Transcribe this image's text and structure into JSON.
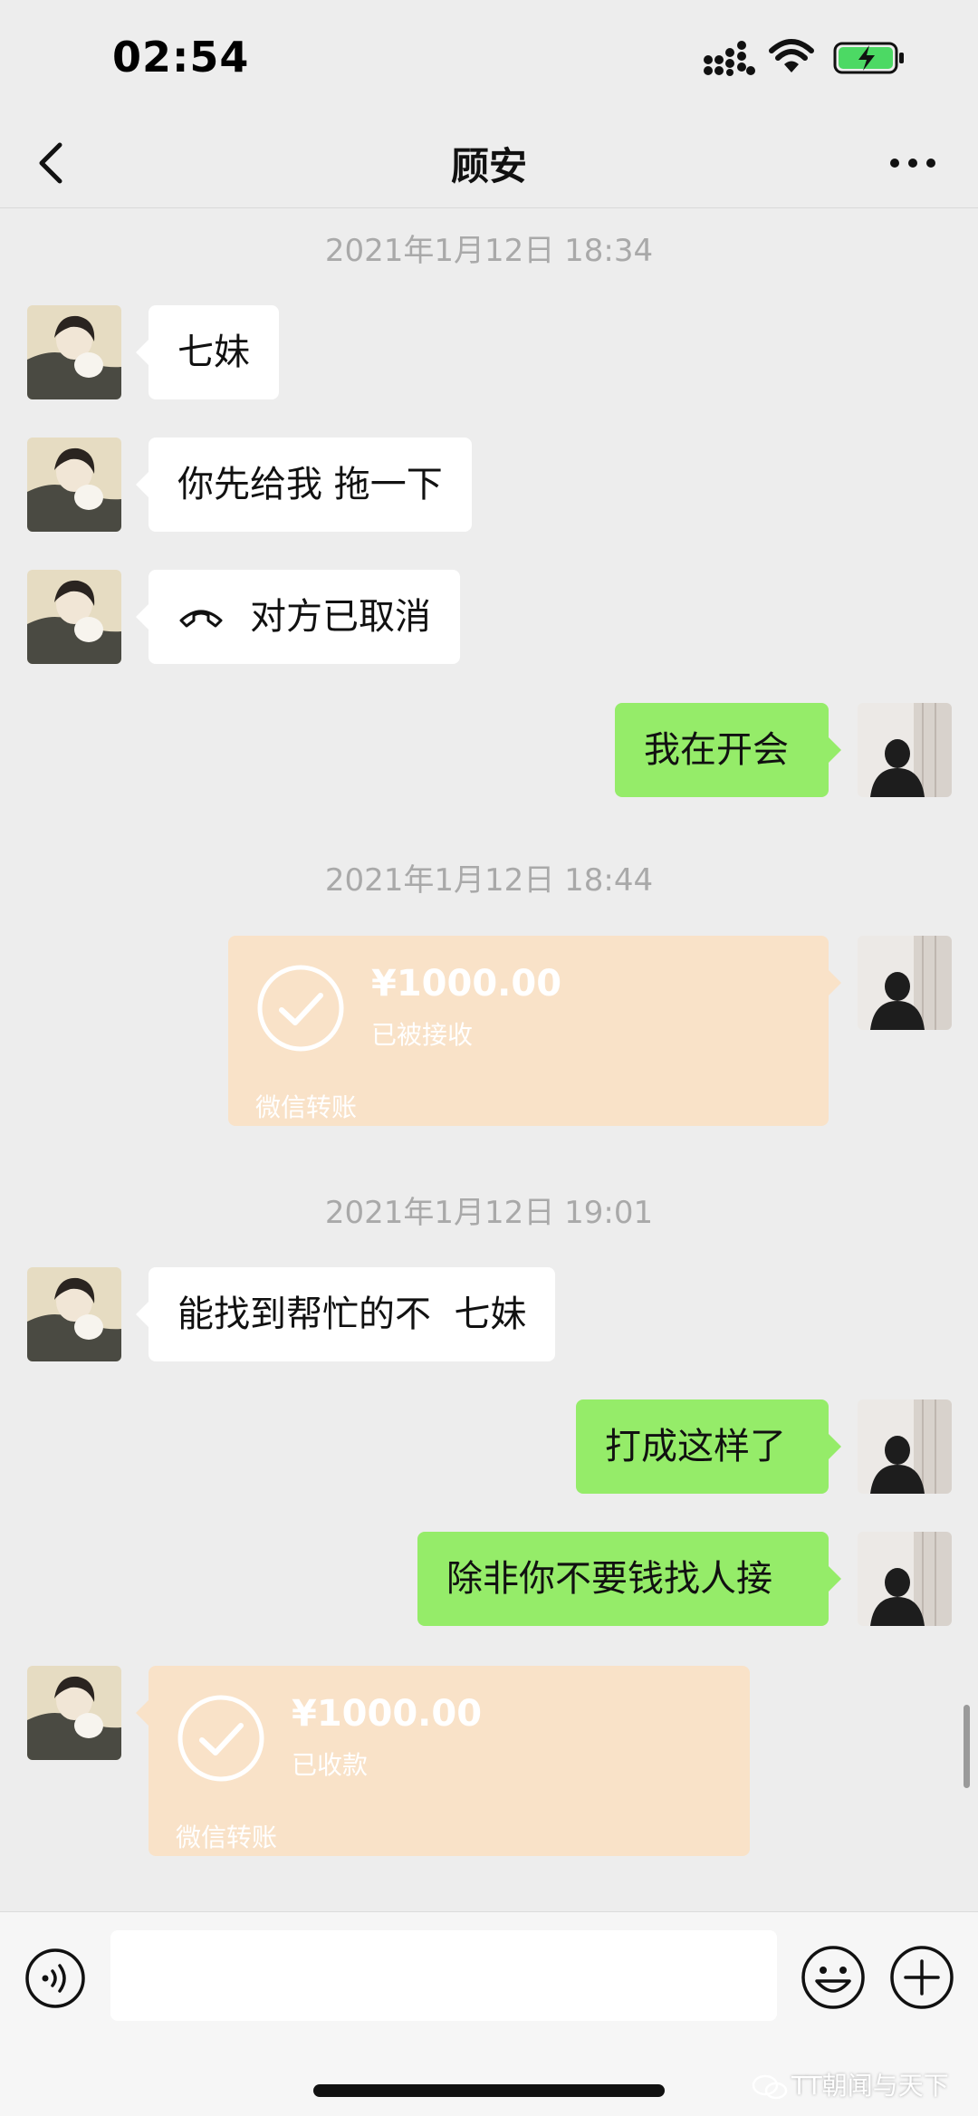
{
  "status_bar": {
    "time": "02:54"
  },
  "nav": {
    "title": "顾安"
  },
  "messages": [
    {
      "type": "timestamp",
      "text": "2021年1月12日 18:34"
    },
    {
      "type": "text",
      "from": "them",
      "text": "七妹"
    },
    {
      "type": "text",
      "from": "them",
      "text": "你先给我 拖一下"
    },
    {
      "type": "call",
      "from": "them",
      "text": "对方已取消",
      "icon": "phone-hangup-icon"
    },
    {
      "type": "text",
      "from": "me",
      "text": "我在开会"
    },
    {
      "type": "timestamp",
      "text": "2021年1月12日 18:44"
    },
    {
      "type": "transfer",
      "from": "me",
      "amount": "¥1000.00",
      "status": "已被接收",
      "brand": "微信转账"
    },
    {
      "type": "timestamp",
      "text": "2021年1月12日 19:01"
    },
    {
      "type": "text",
      "from": "them",
      "text": "能找到帮忙的不  七妹"
    },
    {
      "type": "text",
      "from": "me",
      "text": "打成这样了"
    },
    {
      "type": "text",
      "from": "me",
      "text": "除非你不要钱找人接"
    },
    {
      "type": "transfer",
      "from": "them",
      "amount": "¥1000.00",
      "status": "已收款",
      "brand": "微信转账"
    }
  ],
  "input_bar": {
    "placeholder": "",
    "value": ""
  },
  "watermark": {
    "text": "TT朝闻与天下"
  },
  "colors": {
    "background": "#ededed",
    "outgoing_bubble": "#95ec69",
    "incoming_bubble": "#ffffff",
    "transfer_card": "#f9e2c8",
    "timestamp_text": "#a9a9a9"
  },
  "icons": [
    "signal-icon",
    "wifi-icon",
    "battery-charging-icon",
    "back-icon",
    "more-icon",
    "voice-icon",
    "emoji-icon",
    "plus-icon",
    "check-circle-icon"
  ]
}
